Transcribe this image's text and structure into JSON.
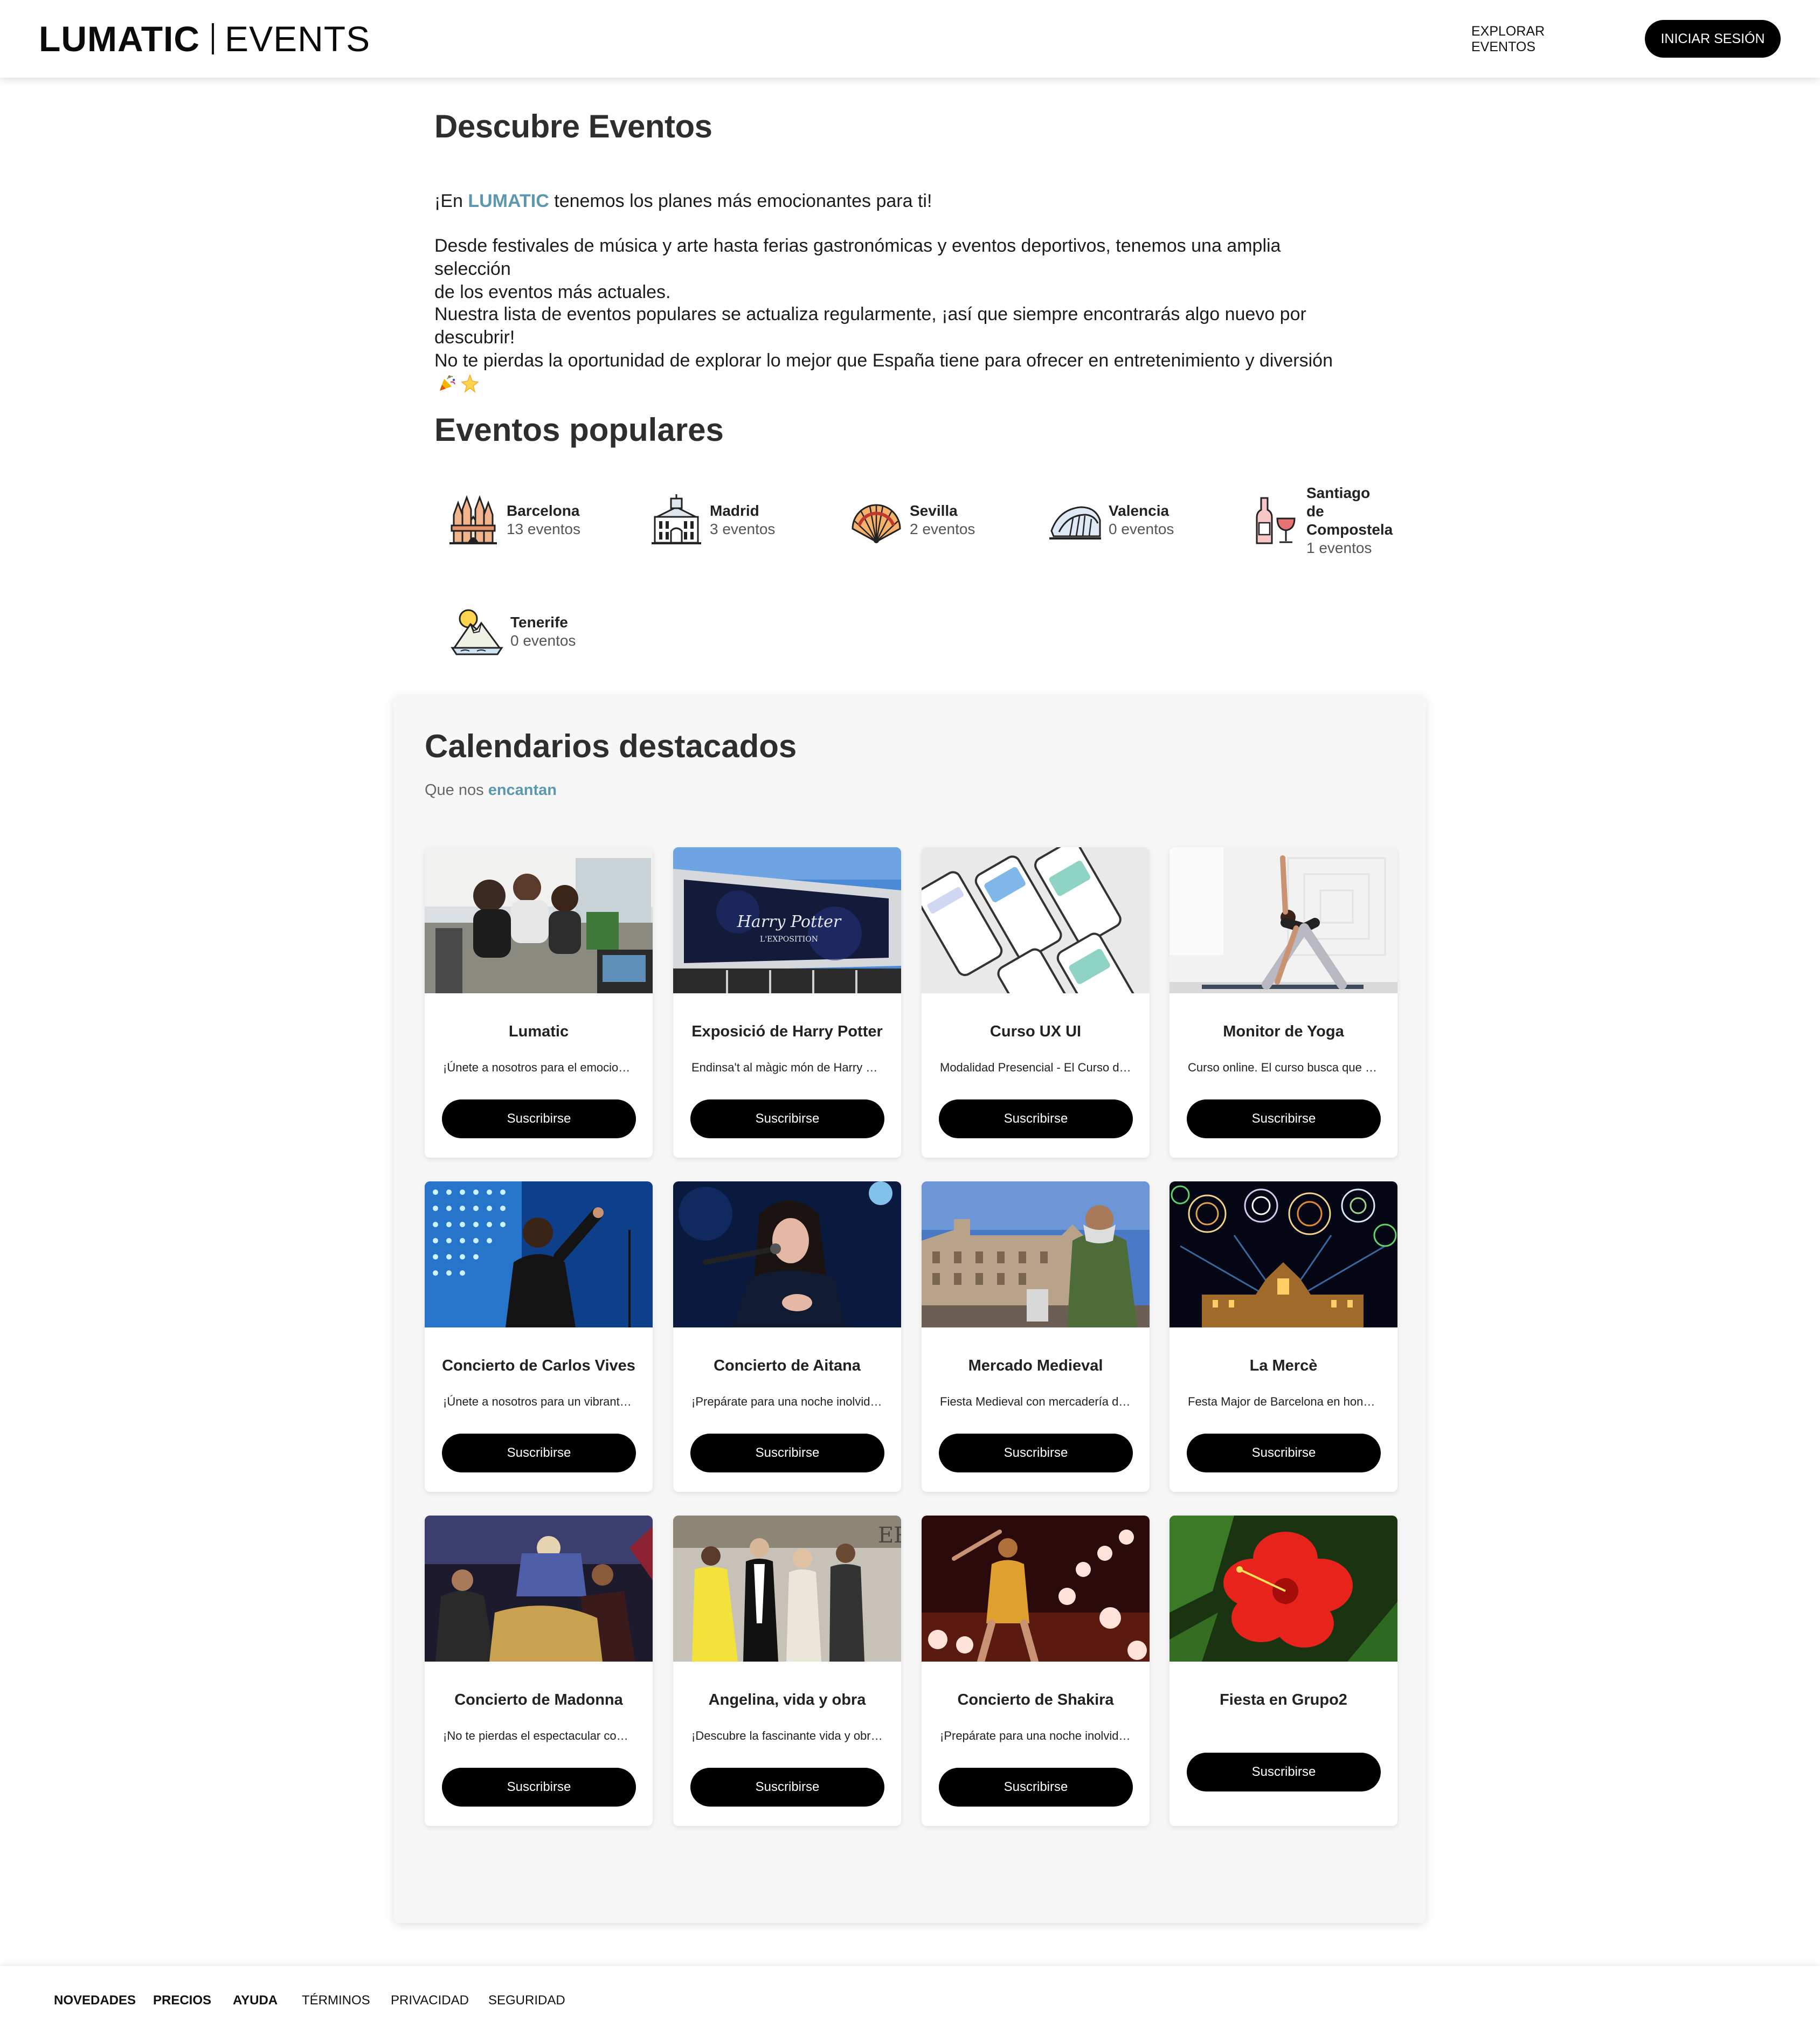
{
  "header": {
    "brand": "LUMATIC",
    "brand_suffix": "EVENTS",
    "explore_label": "EXPLORAR EVENTOS",
    "login_label": "INICIAR SESIÓN"
  },
  "intro": {
    "title": "Descubre Eventos",
    "p1_pre": "¡En ",
    "p1_brand": "LUMATIC",
    "p1_post": " tenemos los planes más emocionantes para ti!",
    "p2_line1": "Desde festivales de música y arte hasta ferias gastronómicas y eventos deportivos, tenemos una amplia selección",
    "p2_line2": "de los eventos más actuales.",
    "p3": "Nuestra lista de eventos populares se actualiza regularmente, ¡así que siempre encontrarás algo nuevo por descubrir!",
    "p4": "No te pierdas la oportunidad de explorar lo mejor que España tiene para ofrecer en entretenimiento y diversión"
  },
  "popular": {
    "title": "Eventos populares",
    "cities": [
      {
        "name": "Barcelona",
        "count": "13 eventos",
        "icon": "sagrada-familia-icon"
      },
      {
        "name": "Madrid",
        "count": "3 eventos",
        "icon": "madrid-building-icon"
      },
      {
        "name": "Sevilla",
        "count": "2 eventos",
        "icon": "fan-icon"
      },
      {
        "name": "Valencia",
        "count": "0 eventos",
        "icon": "ciudad-artes-icon"
      },
      {
        "name": "Santiago de Compostela",
        "name_lines": [
          "Santiago",
          "de",
          "Compostela"
        ],
        "count": "1 eventos",
        "icon": "wine-bottle-icon"
      },
      {
        "name": "Tenerife",
        "count": "0 eventos",
        "icon": "teide-mountain-icon"
      }
    ]
  },
  "featured": {
    "title": "Calendarios destacados",
    "subtitle_pre": "Que nos ",
    "subtitle_accent": "encantan",
    "cards": [
      {
        "title": "Lumatic",
        "desc": "¡Únete a nosotros para el emocionante evento de Lumatic",
        "button": "Suscribirse"
      },
      {
        "title": "Exposició de Harry Potter",
        "desc": "Endinsa't al màgic món de Harry Potter",
        "button": "Suscribirse"
      },
      {
        "title": "Curso UX UI",
        "desc": "Modalidad Presencial - El Curso de diseño UX UI",
        "button": "Suscribirse"
      },
      {
        "title": "Monitor de Yoga",
        "desc": "Curso online. El curso busca que el alumno",
        "button": "Suscribirse"
      },
      {
        "title": "Concierto de Carlos Vives",
        "desc": "¡Únete a nosotros para un vibrante concierto",
        "button": "Suscribirse"
      },
      {
        "title": "Concierto de Aitana",
        "desc": "¡Prepárate para una noche inolvidable con Aitana",
        "button": "Suscribirse"
      },
      {
        "title": "Mercado Medieval",
        "desc": "Fiesta Medieval con mercadería de artesanos",
        "button": "Suscribirse"
      },
      {
        "title": "La Mercè",
        "desc": "Festa Major de Barcelona en honor a la Mercè",
        "button": "Suscribirse"
      },
      {
        "title": "Concierto de Madonna",
        "desc": "¡No te pierdas el espectacular concierto de Madonna",
        "button": "Suscribirse"
      },
      {
        "title": "Angelina, vida y obra",
        "desc": "¡Descubre la fascinante vida y obra de Angelina",
        "button": "Suscribirse"
      },
      {
        "title": "Concierto de Shakira",
        "desc": "¡Prepárate para una noche inolvidable con Shakira",
        "button": "Suscribirse"
      },
      {
        "title": "Fiesta en Grupo2",
        "desc": "",
        "button": "Suscribirse"
      }
    ]
  },
  "footer": {
    "links": [
      "NOVEDADES",
      "PRECIOS",
      "AYUDA",
      "TÉRMINOS",
      "PRIVACIDAD",
      "SEGURIDAD"
    ]
  },
  "colors": {
    "accent": "#5b98b0",
    "button": "#000000",
    "panel": "#f7f7f7"
  }
}
